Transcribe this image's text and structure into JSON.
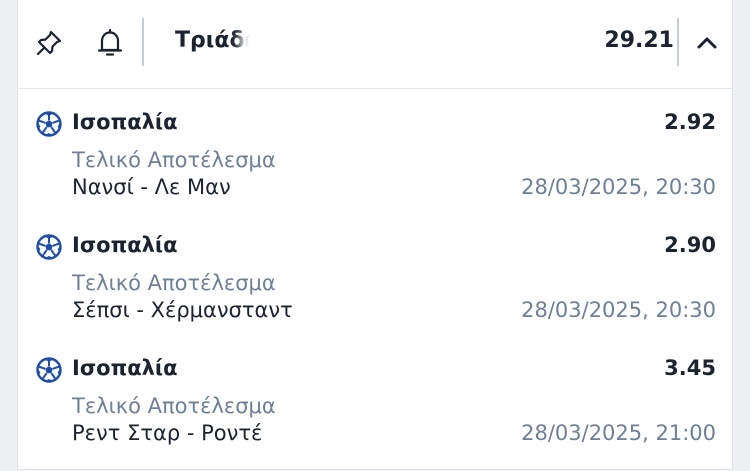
{
  "header": {
    "title": "Τριάδα",
    "total_odds": "29.21",
    "icons": {
      "pin": "pin-icon",
      "bell": "bell-icon",
      "collapse": "chevron-up-icon"
    }
  },
  "selections": [
    {
      "sport_icon": "soccer-ball-icon",
      "market": "Ισοπαλία",
      "odds": "2.92",
      "market_type": "Τελικό Αποτέλεσμα",
      "match": "Νανσί - Λε Μαν",
      "datetime": "28/03/2025, 20:30"
    },
    {
      "sport_icon": "soccer-ball-icon",
      "market": "Ισοπαλία",
      "odds": "2.90",
      "market_type": "Τελικό Αποτέλεσμα",
      "match": "Σέπσι - Χέρμανσταντ",
      "datetime": "28/03/2025, 20:30"
    },
    {
      "sport_icon": "soccer-ball-icon",
      "market": "Ισοπαλία",
      "odds": "3.45",
      "market_type": "Τελικό Αποτέλεσμα",
      "match": "Ρεντ Σταρ - Ροντέ",
      "datetime": "28/03/2025, 21:00"
    }
  ],
  "colors": {
    "text_primary": "#1c2330",
    "text_secondary": "#6f7f96",
    "ball_blue": "#1f4ea3"
  }
}
